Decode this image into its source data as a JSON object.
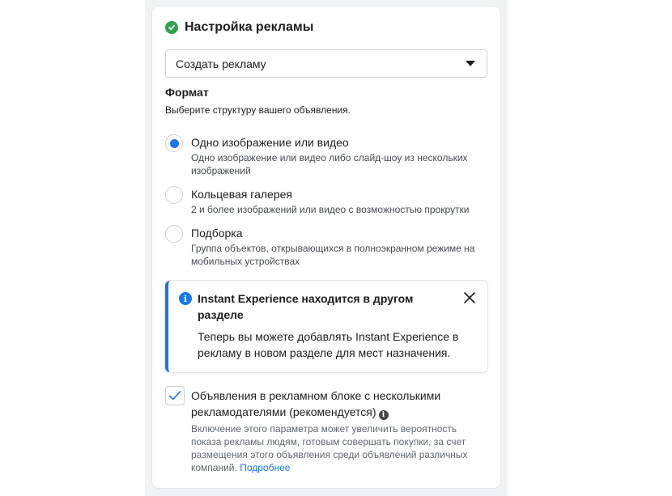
{
  "ad_setup": {
    "title": "Настройка рекламы",
    "dropdown_value": "Создать рекламу"
  },
  "format": {
    "title": "Формат",
    "subtitle": "Выберите структуру вашего объявления.",
    "options": [
      {
        "label": "Одно изображение или видео",
        "description": "Одно изображение или видео либо слайд-шоу из нескольких изображений",
        "selected": true
      },
      {
        "label": "Кольцевая галерея",
        "description": "2 и более изображений или видео с возможностью прокрутки",
        "selected": false
      },
      {
        "label": "Подборка",
        "description": "Группа объектов, открывающихся в полноэкранном режиме на мобильных устройствах",
        "selected": false
      }
    ]
  },
  "notice": {
    "title": "Instant Experience находится в другом разделе",
    "body": "Теперь вы можете добавлять Instant Experience в рекламу в новом разделе для мест назначения."
  },
  "multi_advertiser": {
    "checked": true,
    "label": "Объявления в рекламном блоке с несколькими рекламодателями (рекомендуется)",
    "description": "Включение этого параметра может увеличить вероятность показа рекламы людям, готовым совершать покупки, за счет размещения этого объявления среди объявлений различных компаний.",
    "link": "Подробнее"
  },
  "colors": {
    "accent": "#1877f2",
    "success": "#31a24c"
  },
  "icons": [
    "check-circle-icon",
    "caret-down-icon",
    "info-icon",
    "close-icon",
    "checkmark-icon"
  ]
}
